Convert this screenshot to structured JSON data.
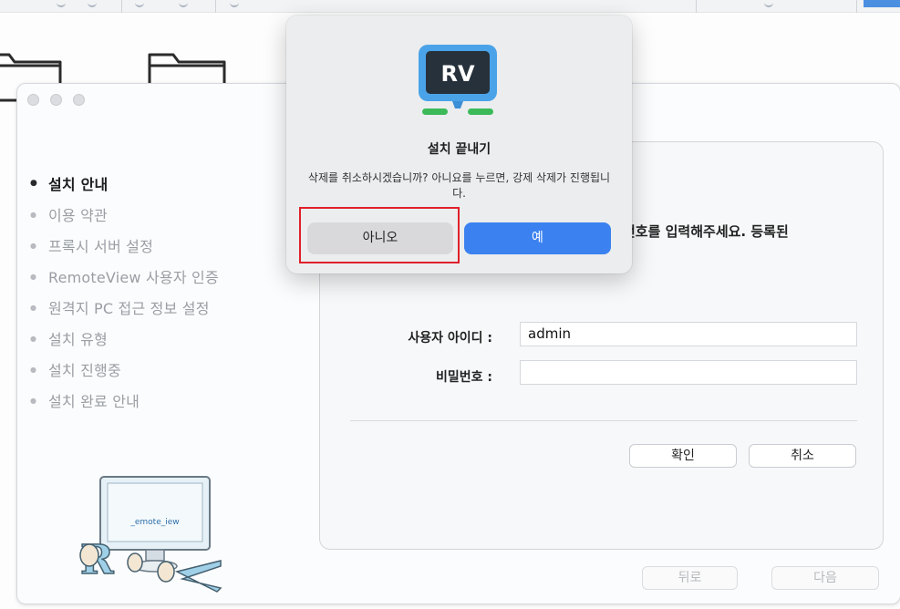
{
  "alert": {
    "app_icon_text": "RV",
    "title": "설치 끝내기",
    "message": "삭제를 취소하시겠습니까? 아니요를 누르면, 강제 삭제가 진행됩니다.",
    "no_label": "아니오",
    "yes_label": "예"
  },
  "sidebar": {
    "steps": [
      {
        "label": "설치 안내",
        "active": true
      },
      {
        "label": "이용 약관",
        "active": false
      },
      {
        "label": "프록시 서버 설정",
        "active": false
      },
      {
        "label": "RemoteView 사용자 인증",
        "active": false
      },
      {
        "label": "원격지 PC 접근 정보 설정",
        "active": false
      },
      {
        "label": "설치 유형",
        "active": false
      },
      {
        "label": "설치 진행중",
        "active": false
      },
      {
        "label": "설치 완료 안내",
        "active": false
      }
    ]
  },
  "content": {
    "prompt_partial": "번호를 입력해주세요. 등록된",
    "user_id_label": "사용자 아이디 :",
    "user_id_value": "admin",
    "password_label": "비밀번호 :",
    "password_value": "",
    "confirm_label": "확인",
    "cancel_label": "취소"
  },
  "footer": {
    "back_label": "뒤로",
    "next_label": "다음"
  },
  "mascot": {
    "screen_text": "_emote_iew"
  },
  "colors": {
    "accent_blue": "#3b82f0",
    "highlight_red": "#e0202a",
    "icon_green": "#3cba5a",
    "icon_blue": "#4aa3e8"
  }
}
